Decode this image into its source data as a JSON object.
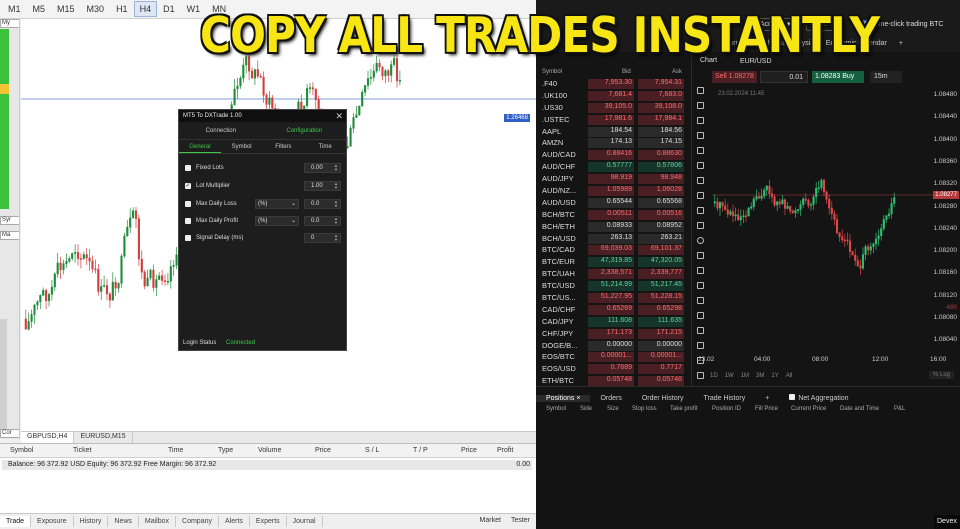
{
  "headline": "COPY ALL TRADES INSTANTLY",
  "mt5": {
    "timeframes": [
      "M1",
      "M5",
      "M15",
      "M30",
      "H1",
      "H4",
      "D1",
      "W1",
      "MN"
    ],
    "active_timeframe": "H4",
    "left_strip_labels": [
      "My",
      "Syr",
      "Ma"
    ],
    "chart_price_tag": "1.26468",
    "symbol_tabs": [
      "GBPUSD,H4",
      "EURUSD,M15"
    ],
    "toolbox_columns": [
      "Symbol",
      "Ticket",
      "Time",
      "Type",
      "Volume",
      "Price",
      "S / L",
      "T / P",
      "Price",
      "Profit"
    ],
    "balance_text": "Balance: 96 372.92 USD  Equity: 96 372.92  Free Margin: 96 372.92",
    "balance_profit": "0.00",
    "bottom_tabs": [
      "Trade",
      "Exposure",
      "History",
      "News",
      "Mailbox",
      "Company",
      "Alerts",
      "Experts",
      "Journal"
    ],
    "bottom_right": [
      "Market",
      "Tester"
    ],
    "left_side_label": "Cor"
  },
  "dialog": {
    "title": "MT5 To DXTrade 1.00",
    "close": "✕",
    "top_tabs": [
      "Connection",
      "Configuration"
    ],
    "sub_tabs": [
      "General",
      "Symbol",
      "Filters",
      "Time"
    ],
    "rows": [
      {
        "label": "Fixed Lots",
        "checked": false,
        "value": "0.00",
        "select": ""
      },
      {
        "label": "Lot Multiplier",
        "checked": true,
        "value": "1.00",
        "select": ""
      },
      {
        "label": "Max Daily Loss",
        "checked": false,
        "value": "0.0",
        "select": "(%)"
      },
      {
        "label": "Max Daily Profit",
        "checked": false,
        "value": "0.0",
        "select": "(%)"
      },
      {
        "label": "Signal Delay (ms)",
        "checked": false,
        "value": "0",
        "select": ""
      }
    ],
    "status_label": "Login Status",
    "status_value": "Connected"
  },
  "dx": {
    "account": "My Account",
    "tools": "Tools",
    "one_click": "One-click trading BTC",
    "tabs": [
      "Journal",
      "Technical Analysis",
      "Economic Calendar",
      "+"
    ],
    "chart_title": "Chart",
    "watch_head": {
      "symbol": "Symbol",
      "bid": "Bid",
      "ask": "Ask"
    },
    "watchlist": [
      {
        "s": ".F40",
        "b": "7,953.30",
        "a": "7,954.31",
        "c": "red"
      },
      {
        "s": ".UK100",
        "b": "7,681.4",
        "a": "7,683.0",
        "c": "red"
      },
      {
        "s": ".US30",
        "b": "39,105.0",
        "a": "39,108.0",
        "c": "red"
      },
      {
        "s": ".USTEC",
        "b": "17,981.6",
        "a": "17,984.1",
        "c": "red"
      },
      {
        "s": "AAPL",
        "b": "184.54",
        "a": "184.56",
        "c": "neu"
      },
      {
        "s": "AMZN",
        "b": "174.13",
        "a": "174.15",
        "c": "neu"
      },
      {
        "s": "AUD/CAD",
        "b": "0.88416",
        "a": "0.88630",
        "c": "red"
      },
      {
        "s": "AUD/CHF",
        "b": "0.57777",
        "a": "0.57806",
        "c": "grn"
      },
      {
        "s": "AUD/JPY",
        "b": "98.919",
        "a": "98.948",
        "c": "red"
      },
      {
        "s": "AUD/NZ...",
        "b": "1.05989",
        "a": "1.06028",
        "c": "red"
      },
      {
        "s": "AUD/USD",
        "b": "0.65544",
        "a": "0.65568",
        "c": "neu"
      },
      {
        "s": "BCH/BTC",
        "b": "0.00511",
        "a": "0.00516",
        "c": "red"
      },
      {
        "s": "BCH/ETH",
        "b": "0.08933",
        "a": "0.08952",
        "c": "neu"
      },
      {
        "s": "BCH/USD",
        "b": "263.13",
        "a": "263.21",
        "c": "neu"
      },
      {
        "s": "BTC/CAD",
        "b": "69,039.03",
        "a": "69,101.37",
        "c": "red"
      },
      {
        "s": "BTC/EUR",
        "b": "47,319.85",
        "a": "47,320.05",
        "c": "grn"
      },
      {
        "s": "BTC/UAH",
        "b": "2,338,571",
        "a": "2,339,777",
        "c": "red"
      },
      {
        "s": "BTC/USD",
        "b": "51,214.99",
        "a": "51,217.45",
        "c": "grn"
      },
      {
        "s": "BTC/US...",
        "b": "51,227.95",
        "a": "51,228.15",
        "c": "red"
      },
      {
        "s": "CAD/CHF",
        "b": "0.65269",
        "a": "0.65298",
        "c": "red"
      },
      {
        "s": "CAD/JPY",
        "b": "111.608",
        "a": "111.635",
        "c": "grn"
      },
      {
        "s": "CHF/JPY",
        "b": "171.173",
        "a": "171.215",
        "c": "red"
      },
      {
        "s": "DOGE/B...",
        "b": "0.00000",
        "a": "0.00000",
        "c": "neu"
      },
      {
        "s": "EOS/BTC",
        "b": "0.00001...",
        "a": "0.00001...",
        "c": "red"
      },
      {
        "s": "EOS/USD",
        "b": "0.7689",
        "a": "0.7717",
        "c": "red"
      },
      {
        "s": "ETH/BTC",
        "b": "0.05748",
        "a": "0.05748",
        "c": "red"
      }
    ],
    "order": {
      "sell": "Sell 1.08278",
      "qty": "0.01",
      "buy": "1.08283 Buy",
      "timeframe": "15m"
    },
    "chart_symbol": "EUR/USD",
    "chart_date": "23.02.2024 11:45",
    "price_axis": [
      "1.08480",
      "1.08440",
      "1.08400",
      "1.08360",
      "1.08320",
      "1.08280",
      "1.08240",
      "1.08200",
      "1.08160",
      "1.08120",
      "1.08080",
      "1.08040"
    ],
    "cur_price": "1.08277",
    "time_axis": [
      "23.02",
      "04:00",
      "08:00",
      "12:00",
      "16:00"
    ],
    "ranges": [
      "1D",
      "1W",
      "1M",
      "3M",
      "1Y",
      "All"
    ],
    "zoom_label": "% Log",
    "extra_tag": "-680",
    "pos_tabs": [
      "Positions ×",
      "Orders",
      "Order History",
      "Trade History",
      "+",
      "Net Aggregation"
    ],
    "pos_columns": [
      "Symbol",
      "Side",
      "Size",
      "Stop loss",
      "Take profit",
      "Position ID",
      "Fill Price",
      "Current Price",
      "Date and Time",
      "P&L"
    ],
    "devex": "Devex"
  },
  "colors": {
    "headline": "#f7e614",
    "up": "#3ec94a",
    "down": "#e04848",
    "accent": "#2b6cd9"
  }
}
